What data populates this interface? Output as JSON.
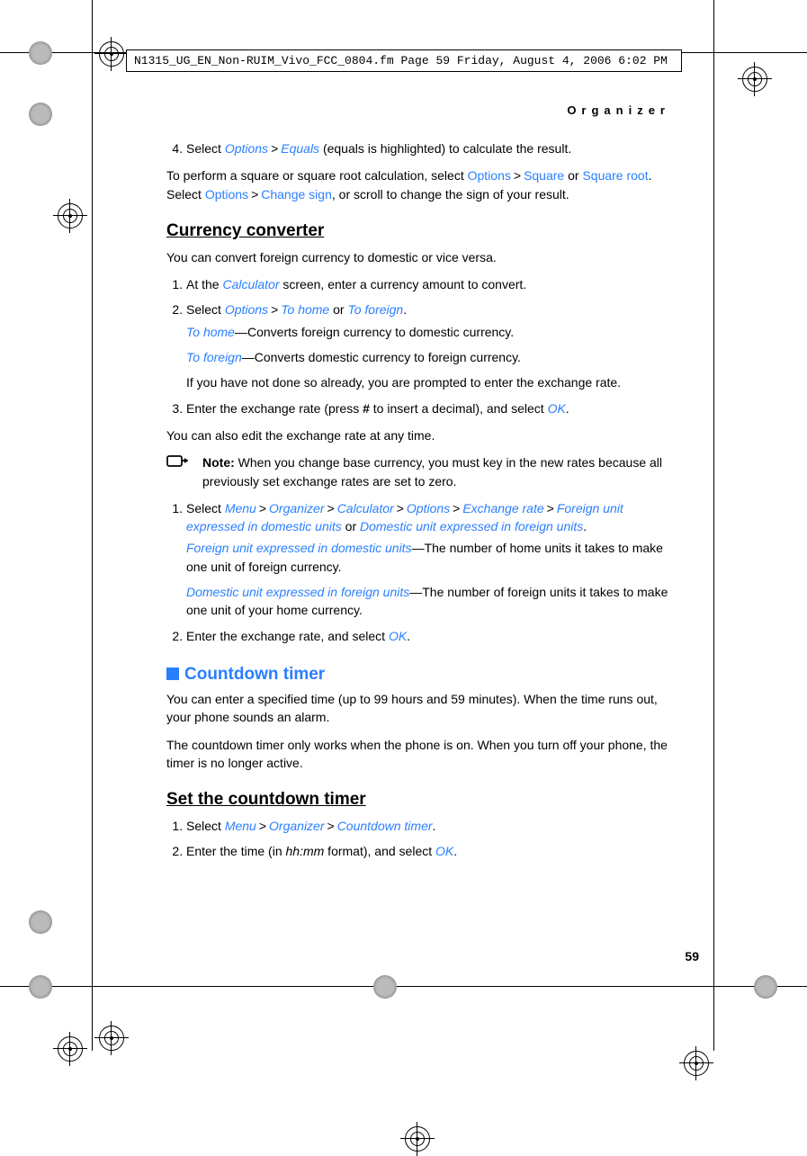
{
  "header_line": "N1315_UG_EN_Non-RUIM_Vivo_FCC_0804.fm  Page 59  Friday, August 4, 2006  6:02 PM",
  "kicker": "Organizer",
  "page_number": "59",
  "gt": ">",
  "step4": {
    "prefix": "Select ",
    "options": "Options",
    "equals": "Equals",
    "rest": " (equals is highlighted) to calculate the result."
  },
  "sqpara": {
    "t1": "To perform a square or square root calculation, select ",
    "options": "Options",
    "sq": "Square",
    "or": " or ",
    "sqroot": "Square root",
    "t2": ". Select ",
    "options2": "Options",
    "cs": "Change sign",
    "t3": ", or scroll to change the sign of your result."
  },
  "currency": {
    "title": "Currency converter",
    "intro": "You can convert foreign currency to domestic or vice versa.",
    "s1a": "At the ",
    "calc": "Calculator",
    "s1b": " screen, enter a currency amount to convert.",
    "s2a": "Select ",
    "opt": "Options",
    "th": "To home",
    "or": " or ",
    "tf": "To foreign",
    "dot": ".",
    "th_def": "—Converts foreign currency to domestic currency.",
    "tf_def": "—Converts domestic currency to foreign currency.",
    "ifnot": "If you have not done so already, you are prompted to enter the exchange rate.",
    "s3a": "Enter the exchange rate (press ",
    "hash": "#",
    "s3b": " to insert a decimal), and select ",
    "ok": "OK",
    "also": "You can also edit the exchange rate at any time.",
    "note_label": "Note:",
    "note_text": " When you change base currency, you must key in the new rates because all previously set exchange rates are set to zero.",
    "m1a": "Select ",
    "menu": "Menu",
    "org": "Organizer",
    "calc2": "Calculator",
    "opt2": "Options",
    "exr": "Exchange rate",
    "fud": "Foreign unit expressed in domestic units",
    "or2": " or ",
    "duf": "Domestic unit expressed in foreign units",
    "fud_def": "—The number of home units it takes to make one unit of foreign currency.",
    "duf_def": "—The number of foreign units it takes to make one unit of your home currency.",
    "m2": "Enter the exchange rate, and select ",
    "ok2": "OK"
  },
  "timer": {
    "title": "Countdown timer",
    "p1": "You can enter a specified time (up to 99 hours and 59 minutes). When the time runs out, your phone sounds an alarm.",
    "p2": "The countdown timer only works when the phone is on. When you turn off your phone, the timer is no longer active.",
    "settitle": "Set the countdown timer",
    "s1a": "Select ",
    "menu": "Menu",
    "org": "Organizer",
    "ct": "Countdown timer",
    "dot": ".",
    "s2a": "Enter the time (in ",
    "hhmm": "hh:mm",
    "s2b": " format), and select ",
    "ok": "OK"
  }
}
